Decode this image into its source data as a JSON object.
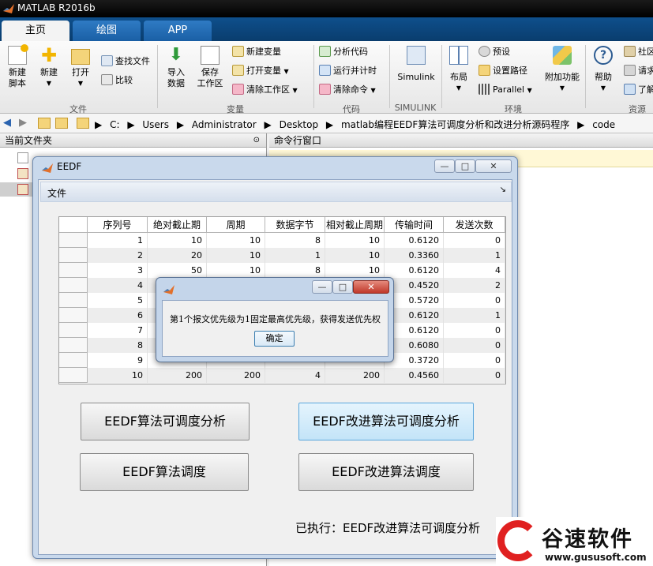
{
  "window": {
    "title": "MATLAB R2016b"
  },
  "tabs": [
    {
      "label": "主页"
    },
    {
      "label": "绘图"
    },
    {
      "label": "APP"
    }
  ],
  "ribbon": {
    "file": {
      "new_script": "新建\n脚本",
      "new": "新建",
      "open": "打开",
      "find_files": "查找文件",
      "compare": "比较",
      "group": "文件"
    },
    "variable": {
      "import": "导入\n数据",
      "save_ws": "保存\n工作区",
      "new_var": "新建变量",
      "open_var": "打开变量",
      "clear_ws": "清除工作区",
      "group": "变量"
    },
    "code": {
      "analyze": "分析代码",
      "run_time": "运行并计时",
      "clear_cmd": "清除命令",
      "group": "代码"
    },
    "simulink": {
      "label": "Simulink",
      "group": "SIMULINK"
    },
    "env": {
      "layout": "布局",
      "prefs": "预设",
      "set_path": "设置路径",
      "parallel": "Parallel",
      "addons": "附加功能",
      "group": "环境"
    },
    "resources": {
      "help": "帮助",
      "community": "社区",
      "request": "请求",
      "learn": "了解",
      "group": "资源"
    }
  },
  "address": {
    "crumbs": [
      "C:",
      "Users",
      "Administrator",
      "Desktop",
      "matlab编程EEDF算法可调度分析和改进分析源码程序",
      "code"
    ]
  },
  "left_panel": {
    "title": "当前文件夹"
  },
  "right_panel": {
    "title": "命令行窗口"
  },
  "figure": {
    "title": "EEDF",
    "menu": "文件",
    "table": {
      "headers": [
        "序列号",
        "绝对截止期",
        "周期",
        "数据字节",
        "相对截止周期",
        "传输时间",
        "发送次数"
      ],
      "rows": [
        [
          "1",
          "10",
          "10",
          "8",
          "10",
          "0.6120",
          "0"
        ],
        [
          "2",
          "20",
          "10",
          "1",
          "10",
          "0.3360",
          "1"
        ],
        [
          "3",
          "50",
          "10",
          "8",
          "10",
          "0.6120",
          "4"
        ],
        [
          "4",
          "",
          "",
          "",
          "",
          "0.4520",
          "2"
        ],
        [
          "5",
          "",
          "",
          "",
          "",
          "0.5720",
          "0"
        ],
        [
          "6",
          "",
          "",
          "",
          "",
          "0.6120",
          "1"
        ],
        [
          "7",
          "",
          "",
          "",
          "",
          "0.6120",
          "0"
        ],
        [
          "8",
          "",
          "",
          "",
          "",
          "0.6080",
          "0"
        ],
        [
          "9",
          "",
          "",
          "",
          "",
          "0.3720",
          "0"
        ],
        [
          "10",
          "200",
          "200",
          "4",
          "200",
          "0.4560",
          "0"
        ]
      ]
    },
    "buttons": {
      "eedf_analysis": "EEDF算法可调度分析",
      "eedf_improved_analysis": "EEDF改进算法可调度分析",
      "eedf_schedule": "EEDF算法调度",
      "eedf_improved_schedule": "EEDF改进算法调度"
    },
    "status": "已执行：EEDF改进算法可调度分析"
  },
  "dialog": {
    "message": "第1个报文优先级为1固定最高优先级，获得发送优先权",
    "ok": "确定"
  },
  "watermark": {
    "brand": "谷速软件",
    "url": "www.gususoft.com"
  }
}
